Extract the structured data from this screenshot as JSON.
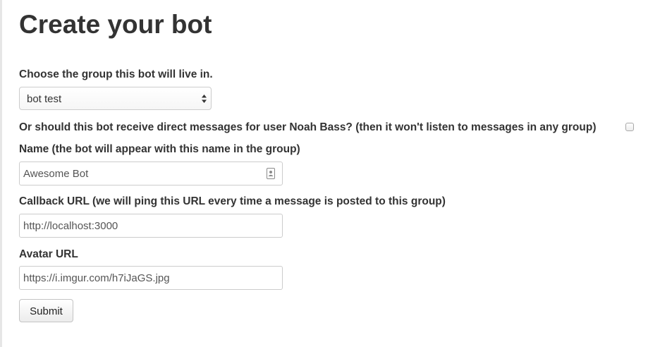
{
  "page": {
    "title": "Create your bot"
  },
  "form": {
    "group_label": "Choose the group this bot will live in.",
    "group_select": {
      "selected": "bot test"
    },
    "direct_messages_label": "Or should this bot receive direct messages for user Noah Bass? (then it won't listen to messages in any group)",
    "direct_messages_checked": false,
    "name_label": "Name (the bot will appear with this name in the group)",
    "name_value": "Awesome Bot",
    "callback_label": "Callback URL (we will ping this URL every time a message is posted to this group)",
    "callback_value": "http://localhost:3000",
    "avatar_label": "Avatar URL",
    "avatar_value": "https://i.imgur.com/h7iJaGS.jpg",
    "submit_label": "Submit"
  },
  "icons": {
    "select_arrows": "up-down-arrows-icon",
    "name_field_autofill": "contact-card-icon"
  }
}
